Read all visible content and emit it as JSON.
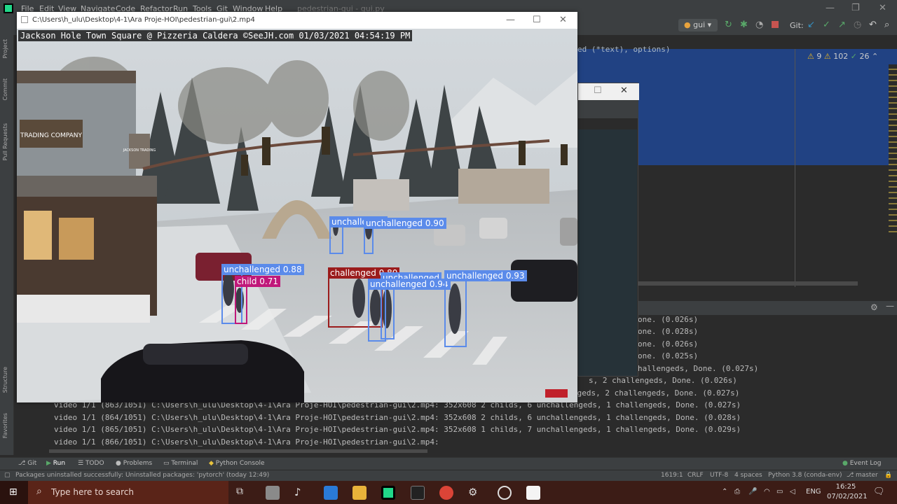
{
  "ide": {
    "menus": [
      "File",
      "Edit",
      "View",
      "Navigate",
      "Code",
      "Refactor",
      "Run",
      "Tools",
      "Git",
      "Window",
      "Help"
    ],
    "project_title": "pedestrian-gui - gui.py",
    "run_config": "gui",
    "git_label": "Git:",
    "project_tab": "Project",
    "commit_tab": "Commit",
    "pull_requests_tab": "Pull Requests",
    "structure_tab": "Structure",
    "favorites_tab": "Favorites",
    "code_fragment": "ed (*text), options)",
    "inspections": {
      "warnings": "9",
      "weak": "102",
      "ok": "26"
    }
  },
  "video_window": {
    "title": "C:\\Users\\h_ulu\\Desktop\\4-1\\Ara Proje-HOI\\pedestrian-gui\\2.mp4",
    "overlay": "Jackson Hole Town Square @ Pizzeria Caldera ©SeeJH.com 01/03/2021 04:54:19 PM",
    "sign_trading_company": "TRADING COMPANY",
    "sign_jackson": "JACKSON TRADING"
  },
  "detections": [
    {
      "label": "unchallenged 0.88",
      "color": "#5b8bea"
    },
    {
      "label": "child 0.71",
      "color": "#c0187a"
    },
    {
      "label": "unchallenged 0.90",
      "color": "#5b8bea"
    },
    {
      "label": "unchalleng...",
      "color": "#5b8bea"
    },
    {
      "label": "challenged 0.80",
      "color": "#9b1c1c"
    },
    {
      "label": "unchallenged",
      "color": "#5b8bea"
    },
    {
      "label": "unchallenged 0.94",
      "color": "#5b8bea"
    },
    {
      "label": "unchallenged 0.93",
      "color": "#5b8bea"
    }
  ],
  "console_right": [
    "one. (0.026s)",
    "one. (0.028s)",
    "one. (0.026s)",
    "one. (0.025s)",
    "hallengeds, Done. (0.027s)",
    "s, 2 challengeds, Done. (0.026s)",
    "ngeds, 2 challengeds, Done. (0.027s)"
  ],
  "console_lines": [
    "video 1/1 (863/1051) C:\\Users\\h_ulu\\Desktop\\4-1\\Ara Proje-HOI\\pedestrian-gui\\2.mp4: 352x608 2 childs, 6 unchallengeds, 1 challengeds, Done. (0.027s)",
    "video 1/1 (864/1051) C:\\Users\\h_ulu\\Desktop\\4-1\\Ara Proje-HOI\\pedestrian-gui\\2.mp4: 352x608 2 childs, 6 unchallengeds, 1 challengeds, Done. (0.028s)",
    "video 1/1 (865/1051) C:\\Users\\h_ulu\\Desktop\\4-1\\Ara Proje-HOI\\pedestrian-gui\\2.mp4: 352x608 1 childs, 7 unchallengeds, 1 challengeds, Done. (0.029s)",
    "video 1/1 (866/1051) C:\\Users\\h_ulu\\Desktop\\4-1\\Ara Proje-HOI\\pedestrian-gui\\2.mp4:"
  ],
  "bottom_tabs": [
    "Git",
    "Run",
    "TODO",
    "Problems",
    "Terminal",
    "Python Console"
  ],
  "event_log": "Event Log",
  "status": {
    "message": "Packages uninstalled successfully: Uninstalled packages: 'pytorch' (today 12:49)",
    "position": "1619:1",
    "line_sep": "CRLF",
    "encoding": "UTF-8",
    "indent": "4 spaces",
    "interpreter": "Python 3.8 (conda-env)",
    "branch": "master"
  },
  "taskbar": {
    "search_placeholder": "Type here to search",
    "lang": "ENG",
    "time": "16:25",
    "date": "07/02/2021"
  }
}
